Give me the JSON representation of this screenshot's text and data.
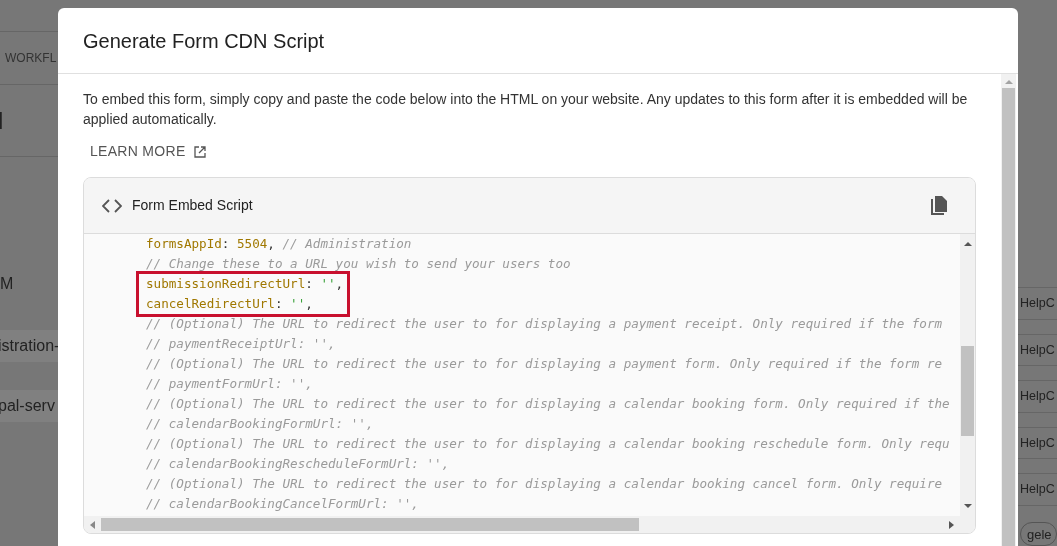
{
  "background": {
    "left_items": [
      {
        "text": "WORKFL",
        "kind": "tab"
      },
      {
        "text": "l",
        "kind": "heading"
      },
      {
        "text": "M",
        "kind": "text"
      },
      {
        "text": "istration-",
        "kind": "row"
      },
      {
        "text": "pal-serv",
        "kind": "row"
      }
    ],
    "right_items": [
      {
        "text": "HelpC"
      },
      {
        "text": "HelpC"
      },
      {
        "text": "HelpC"
      },
      {
        "text": "HelpC"
      },
      {
        "text": "HelpC"
      }
    ],
    "chip": "gele"
  },
  "dialog": {
    "title": "Generate Form CDN Script",
    "description": "To embed this form, simply copy and paste the code below into the HTML on your website. Any updates to this form after it is embedded will be applied automatically.",
    "learn_more": "LEARN MORE",
    "card": {
      "title": "Form Embed Script",
      "lines": [
        {
          "highlighted": false,
          "tokens": [
            {
              "kind": "key",
              "text": "formsAppId"
            },
            {
              "kind": "punct",
              "text": ": "
            },
            {
              "kind": "number",
              "text": "5504"
            },
            {
              "kind": "punct",
              "text": ", "
            },
            {
              "kind": "comment",
              "text": "// Administration"
            }
          ]
        },
        {
          "highlighted": false,
          "tokens": [
            {
              "kind": "comment",
              "text": "// Change these to a URL you wish to send your users too"
            }
          ]
        },
        {
          "highlighted": true,
          "tokens": [
            {
              "kind": "key",
              "text": "submissionRedirectUrl"
            },
            {
              "kind": "punct",
              "text": ": "
            },
            {
              "kind": "string",
              "text": "''"
            },
            {
              "kind": "punct",
              "text": ","
            }
          ]
        },
        {
          "highlighted": true,
          "tokens": [
            {
              "kind": "key",
              "text": "cancelRedirectUrl"
            },
            {
              "kind": "punct",
              "text": ": "
            },
            {
              "kind": "string",
              "text": "''"
            },
            {
              "kind": "punct",
              "text": ","
            }
          ]
        },
        {
          "highlighted": false,
          "tokens": [
            {
              "kind": "comment",
              "text": "// (Optional) The URL to redirect the user to for displaying a payment receipt. Only required if the form"
            }
          ]
        },
        {
          "highlighted": false,
          "tokens": [
            {
              "kind": "comment",
              "text": "// paymentReceiptUrl: '',"
            }
          ]
        },
        {
          "highlighted": false,
          "tokens": [
            {
              "kind": "comment",
              "text": "// (Optional) The URL to redirect the user to for displaying a payment form. Only required if the form re"
            }
          ]
        },
        {
          "highlighted": false,
          "tokens": [
            {
              "kind": "comment",
              "text": "// paymentFormUrl: '',"
            }
          ]
        },
        {
          "highlighted": false,
          "tokens": [
            {
              "kind": "comment",
              "text": "// (Optional) The URL to redirect the user to for displaying a calendar booking form. Only required if the"
            }
          ]
        },
        {
          "highlighted": false,
          "tokens": [
            {
              "kind": "comment",
              "text": "// calendarBookingFormUrl: '',"
            }
          ]
        },
        {
          "highlighted": false,
          "tokens": [
            {
              "kind": "comment",
              "text": "// (Optional) The URL to redirect the user to for displaying a calendar booking reschedule form. Only requ"
            }
          ]
        },
        {
          "highlighted": false,
          "tokens": [
            {
              "kind": "comment",
              "text": "// calendarBookingRescheduleFormUrl: '',"
            }
          ]
        },
        {
          "highlighted": false,
          "tokens": [
            {
              "kind": "comment",
              "text": "// (Optional) The URL to redirect the user to for displaying a calendar booking cancel form. Only require"
            }
          ]
        },
        {
          "highlighted": false,
          "tokens": [
            {
              "kind": "comment",
              "text": "// calendarBookingCancelFormUrl: '',"
            }
          ]
        }
      ]
    }
  }
}
